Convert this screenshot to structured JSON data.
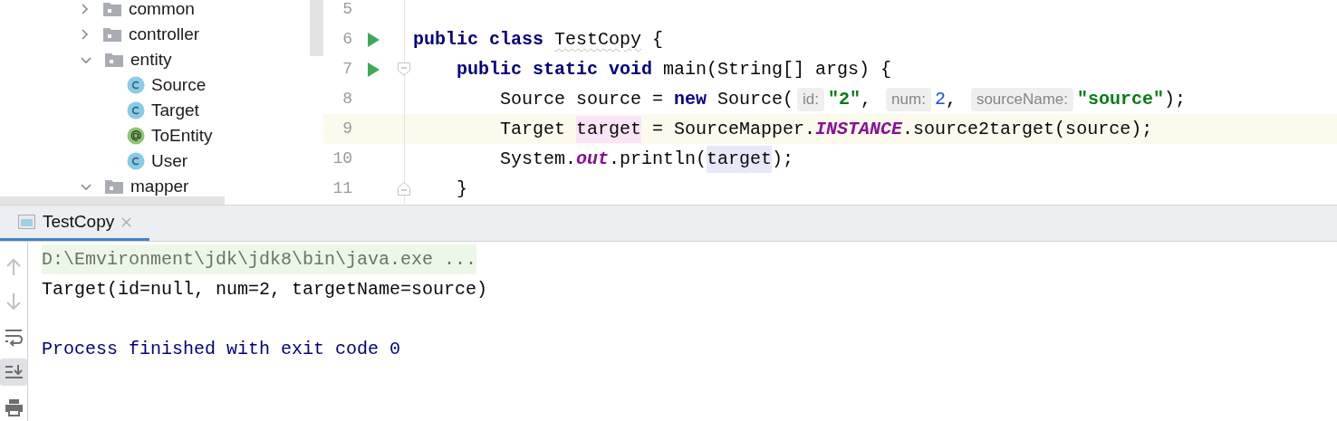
{
  "project_tree": [
    {
      "name": "common",
      "kind": "folder",
      "expanded": false
    },
    {
      "name": "controller",
      "kind": "folder",
      "expanded": false
    },
    {
      "name": "entity",
      "kind": "folder",
      "expanded": true,
      "children": [
        {
          "name": "Source",
          "kind": "class"
        },
        {
          "name": "Target",
          "kind": "class"
        },
        {
          "name": "ToEntity",
          "kind": "annotation"
        },
        {
          "name": "User",
          "kind": "class"
        }
      ]
    },
    {
      "name": "mapper",
      "kind": "folder",
      "expanded": true
    }
  ],
  "editor": {
    "lines": [
      {
        "number": "5",
        "run": false,
        "fold_start": false,
        "fold_end": false,
        "current": false
      },
      {
        "number": "6",
        "run": true,
        "fold_start": false,
        "fold_end": false,
        "current": false,
        "tokens": [
          {
            "text": "public class ",
            "kind": "keyword"
          },
          {
            "text": "TestCopy",
            "kind": "typo"
          },
          {
            "text": " {",
            "kind": "plain"
          }
        ]
      },
      {
        "number": "7",
        "run": true,
        "fold_start": true,
        "fold_end": false,
        "current": false,
        "tokens": [
          {
            "text": "    public static void",
            "kind": "keyword"
          },
          {
            "text": " main(String[] args) {",
            "kind": "plain"
          }
        ]
      },
      {
        "number": "8",
        "run": false,
        "fold_start": false,
        "fold_end": false,
        "current": false,
        "tokens": [
          {
            "text": "        Source source = ",
            "kind": "plain"
          },
          {
            "text": "new",
            "kind": "keyword"
          },
          {
            "text": " Source(",
            "kind": "plain"
          },
          {
            "text": "id:",
            "kind": "hint"
          },
          {
            "text": "\"2\"",
            "kind": "string"
          },
          {
            "text": ", ",
            "kind": "plain"
          },
          {
            "text": "num:",
            "kind": "hint"
          },
          {
            "text": "2",
            "kind": "number"
          },
          {
            "text": ", ",
            "kind": "plain"
          },
          {
            "text": "sourceName:",
            "kind": "hint"
          },
          {
            "text": "\"source\"",
            "kind": "string"
          },
          {
            "text": ");",
            "kind": "plain"
          }
        ]
      },
      {
        "number": "9",
        "run": false,
        "fold_start": false,
        "fold_end": false,
        "current": true,
        "tokens": [
          {
            "text": "        Target ",
            "kind": "plain"
          },
          {
            "text": "target",
            "kind": "write_usage"
          },
          {
            "text": " = SourceMapper.",
            "kind": "plain"
          },
          {
            "text": "INSTANCE",
            "kind": "static"
          },
          {
            "text": ".source2target(source);",
            "kind": "plain"
          }
        ]
      },
      {
        "number": "10",
        "run": false,
        "fold_start": false,
        "fold_end": false,
        "current": false,
        "tokens": [
          {
            "text": "        System.",
            "kind": "plain"
          },
          {
            "text": "out",
            "kind": "static"
          },
          {
            "text": ".println(",
            "kind": "plain"
          },
          {
            "text": "target",
            "kind": "read_usage"
          },
          {
            "text": ");",
            "kind": "plain"
          }
        ]
      },
      {
        "number": "11",
        "run": false,
        "fold_start": false,
        "fold_end": true,
        "current": false,
        "tokens": [
          {
            "text": "    }",
            "kind": "plain"
          }
        ]
      }
    ]
  },
  "run_panel": {
    "tabs": [
      {
        "label": "TestCopy",
        "selected": true
      }
    ],
    "toolbar": [
      {
        "kind": "up",
        "disabled": true,
        "selected": false
      },
      {
        "kind": "down",
        "disabled": true,
        "selected": false
      },
      {
        "kind": "wrap",
        "disabled": false,
        "selected": false
      },
      {
        "kind": "scroll_end",
        "disabled": false,
        "selected": true
      },
      {
        "kind": "print",
        "disabled": false,
        "selected": false
      }
    ],
    "output": [
      {
        "text": "D:\\Emvironment\\jdk\\jdk8\\bin\\java.exe ...",
        "kind": "command"
      },
      {
        "text": "Target(id=null, num=2, targetName=source)",
        "kind": "stdout"
      },
      {
        "text": "Process finished with exit code 0",
        "kind": "system"
      }
    ]
  }
}
